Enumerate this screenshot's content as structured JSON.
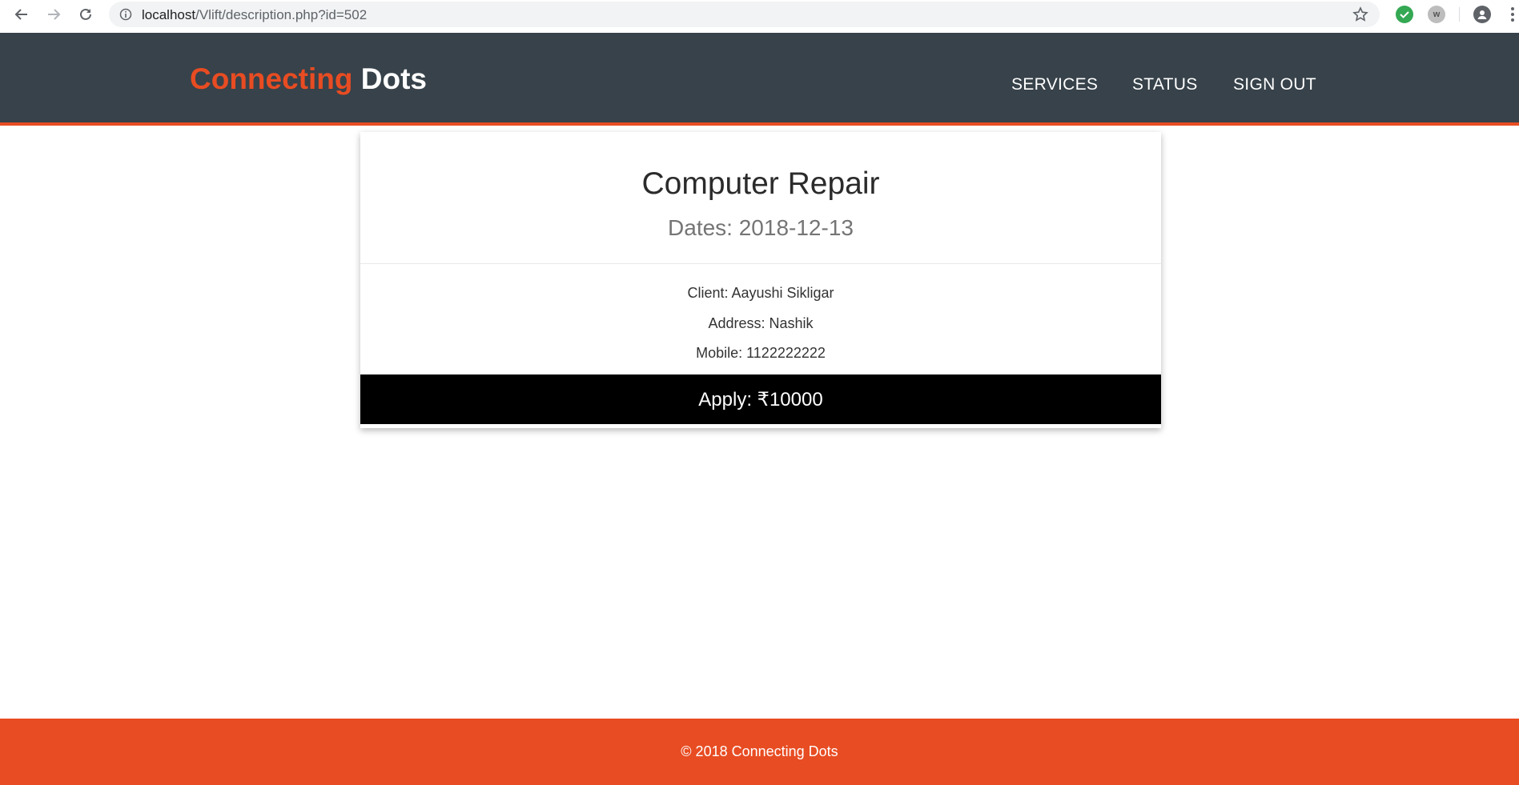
{
  "browser": {
    "url_host": "localhost",
    "url_path": "/Vlift/description.php?id=502",
    "extension_w_label": "w"
  },
  "header": {
    "brand_part1": "Connecting",
    "brand_part2": "Dots",
    "nav": {
      "services": "SERVICES",
      "status": "STATUS",
      "sign_out": "SIGN OUT"
    }
  },
  "service": {
    "title": "Computer Repair",
    "dates": "Dates: 2018-12-13",
    "client": "Client: Aayushi Sikligar",
    "address": "Address: Nashik",
    "mobile": "Mobile: 1122222222",
    "apply_label": "Apply: ₹10000"
  },
  "footer": {
    "copyright": "© 2018 Connecting Dots"
  },
  "colors": {
    "accent": "#e84c22",
    "header_bg": "#37424a",
    "button_bg": "#000000"
  }
}
